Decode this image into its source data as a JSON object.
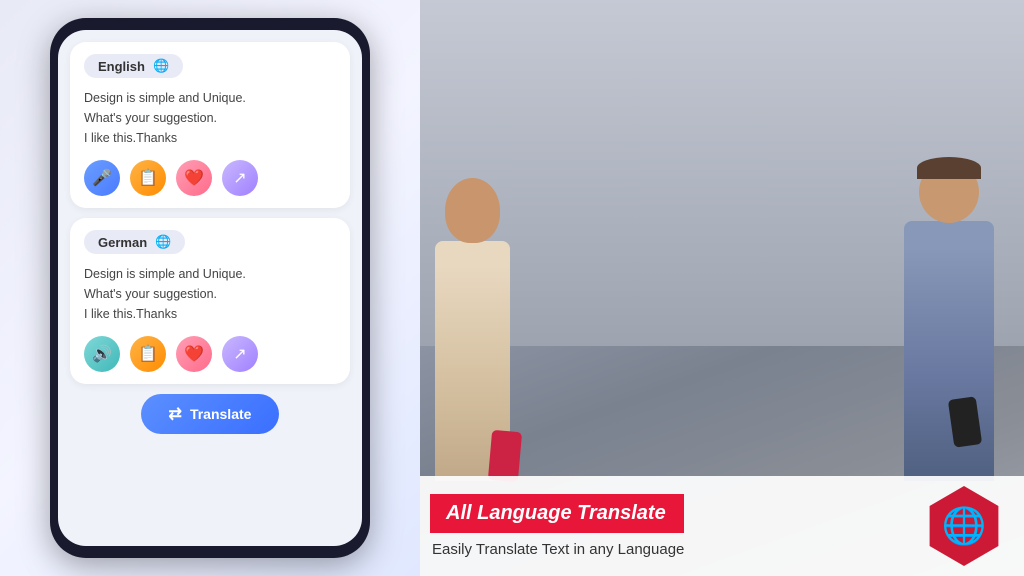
{
  "left_panel": {
    "background": "#e8eaf6"
  },
  "phone": {
    "source_card": {
      "language": "English",
      "globe_icon": "🌐",
      "text": "Design is simple and Unique.\nWhat's your suggestion.\nI like this.Thanks",
      "buttons": [
        {
          "icon": "🎤",
          "color": "btn-blue",
          "label": "microphone"
        },
        {
          "icon": "📋",
          "color": "btn-orange",
          "label": "copy"
        },
        {
          "icon": "❤️",
          "color": "btn-pink",
          "label": "favorite"
        },
        {
          "icon": "↗",
          "color": "btn-purple",
          "label": "share"
        }
      ]
    },
    "target_card": {
      "language": "German",
      "globe_icon": "🌐",
      "text": "Design is simple and Unique.\nWhat's your suggestion.\nI like this.Thanks",
      "buttons": [
        {
          "icon": "🔊",
          "color": "btn-teal",
          "label": "speaker"
        },
        {
          "icon": "📋",
          "color": "btn-orange",
          "label": "copy"
        },
        {
          "icon": "❤️",
          "color": "btn-pink",
          "label": "favorite"
        },
        {
          "icon": "↗",
          "color": "btn-purple",
          "label": "share"
        }
      ]
    },
    "translate_button": {
      "label": "Translate",
      "icon": "⇄"
    }
  },
  "bottom_bar": {
    "title": "All Language Translate",
    "subtitle": "Easily Translate Text in any  Language",
    "globe_icon": "🌐"
  }
}
